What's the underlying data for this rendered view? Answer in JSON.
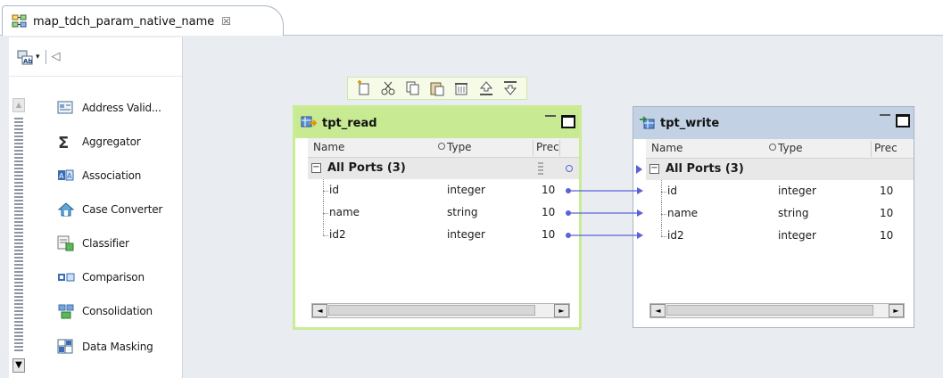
{
  "tab": {
    "title": "map_tdch_param_native_name",
    "close_glyph": "☒",
    "icon": "mapping-icon"
  },
  "palette": {
    "toolbar": {
      "icon": "palette-view-icon",
      "dropdown_glyph": "▾",
      "back_glyph": "◁"
    },
    "scroll_up_glyph": "▲",
    "scroll_down_glyph": "▼",
    "items": [
      {
        "label": "Address Valid...",
        "icon": "address-validator-icon"
      },
      {
        "label": "Aggregator",
        "icon": "sigma-icon"
      },
      {
        "label": "Association",
        "icon": "association-icon"
      },
      {
        "label": "Case Converter",
        "icon": "case-converter-icon"
      },
      {
        "label": "Classifier",
        "icon": "classifier-icon"
      },
      {
        "label": "Comparison",
        "icon": "comparison-icon"
      },
      {
        "label": "Consolidation",
        "icon": "consolidation-icon"
      },
      {
        "label": "Data Masking",
        "icon": "data-masking-icon"
      }
    ]
  },
  "object_toolbar": [
    "new-port-icon",
    "cut-icon",
    "copy-icon",
    "paste-icon",
    "delete-icon",
    "move-up-icon",
    "move-down-icon"
  ],
  "read": {
    "title": "tpt_read",
    "columns": {
      "name": "Name",
      "type": "Type",
      "prec": "Prec"
    },
    "group": {
      "expander": "⊟",
      "label": "All Ports (3)"
    },
    "ports": [
      {
        "name": "id",
        "type": "integer",
        "prec": "10"
      },
      {
        "name": "name",
        "type": "string",
        "prec": "10"
      },
      {
        "name": "id2",
        "type": "integer",
        "prec": "10"
      }
    ],
    "scroll_left": "◄",
    "scroll_right": "►"
  },
  "write": {
    "title": "tpt_write",
    "columns": {
      "name": "Name",
      "type": "Type",
      "prec": "Prec"
    },
    "group": {
      "expander": "⊟",
      "label": "All Ports (3)"
    },
    "ports": [
      {
        "name": "id",
        "type": "integer",
        "prec": "10"
      },
      {
        "name": "name",
        "type": "string",
        "prec": "10"
      },
      {
        "name": "id2",
        "type": "integer",
        "prec": "10"
      }
    ],
    "scroll_left": "◄",
    "scroll_right": "►"
  },
  "colors": {
    "read_header": "#c8ea92",
    "write_header": "#c2d2e4",
    "link": "#5a62d8"
  }
}
